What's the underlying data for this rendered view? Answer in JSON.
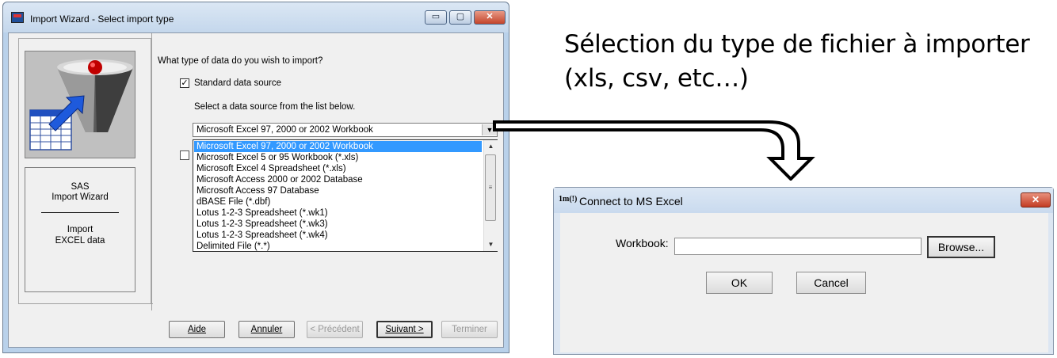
{
  "wizard": {
    "title": "Import Wizard - Select import type",
    "caption_buttons": {
      "minimize": "▭",
      "maximize": "▢",
      "close": "✕"
    },
    "question": "What type of data do you wish to import?",
    "standard_checkbox": {
      "label": "Standard data source",
      "checked": true,
      "mark": "✓"
    },
    "select_hint": "Select a data source from the list below.",
    "combo": {
      "value": "Microsoft Excel 97, 2000 or 2002 Workbook",
      "arrow": "▼"
    },
    "dropdown": {
      "items": [
        "Microsoft Excel 97, 2000 or 2002 Workbook",
        "Microsoft Excel 5 or 95 Workbook (*.xls)",
        "Microsoft Excel 4 Spreadsheet (*.xls)",
        "Microsoft Access 2000 or 2002 Database",
        "Microsoft Access 97 Database",
        "dBASE File (*.dbf)",
        "Lotus 1-2-3 Spreadsheet (*.wk1)",
        "Lotus 1-2-3 Spreadsheet (*.wk3)",
        "Lotus 1-2-3 Spreadsheet (*.wk4)",
        "Delimited File (*.*)"
      ],
      "selected_index": 0,
      "scroll_up": "▲",
      "scroll_grip": "≡",
      "scroll_down": "▼"
    },
    "info": {
      "line1": "SAS",
      "line2": "Import Wizard",
      "line3": "Import",
      "line4": "EXCEL data"
    },
    "buttons": {
      "aide": "Aide",
      "annuler": "Annuler",
      "precedent": "< Précédent",
      "suivant": "Suivant >",
      "terminer": "Terminer"
    }
  },
  "caption": {
    "line1": "Sélection du type de fichier à importer",
    "line2": "(xls, csv, etc…)"
  },
  "excel_dialog": {
    "icon": "1m(!)",
    "title": "Connect to MS Excel",
    "close": "✕",
    "workbook_label": "Workbook:",
    "workbook_value": "",
    "browse_label": "Browse...",
    "ok_label": "OK",
    "cancel_label": "Cancel"
  },
  "colors": {
    "selection": "#3399ff",
    "title_bar": "#c4d7ec",
    "close_button": "#c3442b"
  }
}
